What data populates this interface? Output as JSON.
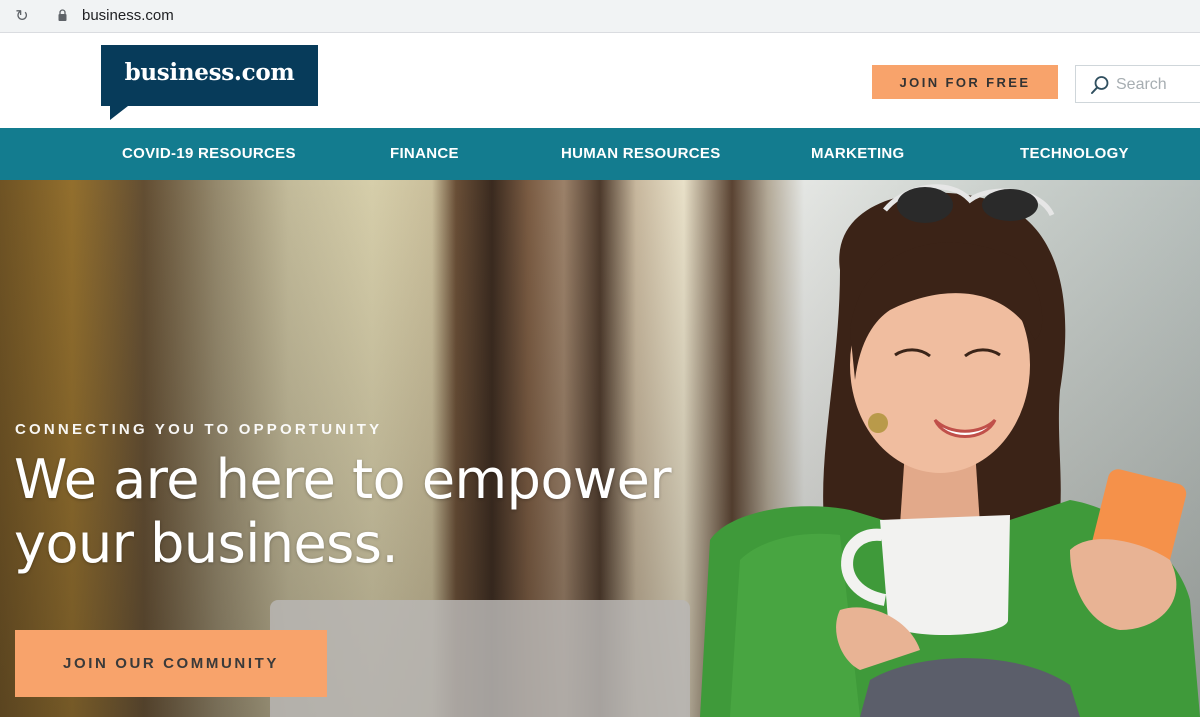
{
  "browser": {
    "url": "business.com",
    "icons": {
      "reload": "reload-icon",
      "lock": "lock-icon"
    }
  },
  "header": {
    "logo_text": "business.com",
    "join_button": "JOIN FOR FREE",
    "search_placeholder": "Search",
    "colors": {
      "logo_bg": "#073b5a",
      "accent": "#f8a36b"
    }
  },
  "nav": {
    "items": [
      {
        "label": "COVID-19 RESOURCES"
      },
      {
        "label": "FINANCE"
      },
      {
        "label": "HUMAN RESOURCES"
      },
      {
        "label": "MARKETING"
      },
      {
        "label": "TECHNOLOGY"
      }
    ],
    "color": "#137c8f"
  },
  "hero": {
    "eyebrow": "CONNECTING YOU TO OPPORTUNITY",
    "headline_line1": "We are here to empower",
    "headline_line2": "your business.",
    "cta": "JOIN OUR COMMUNITY"
  }
}
